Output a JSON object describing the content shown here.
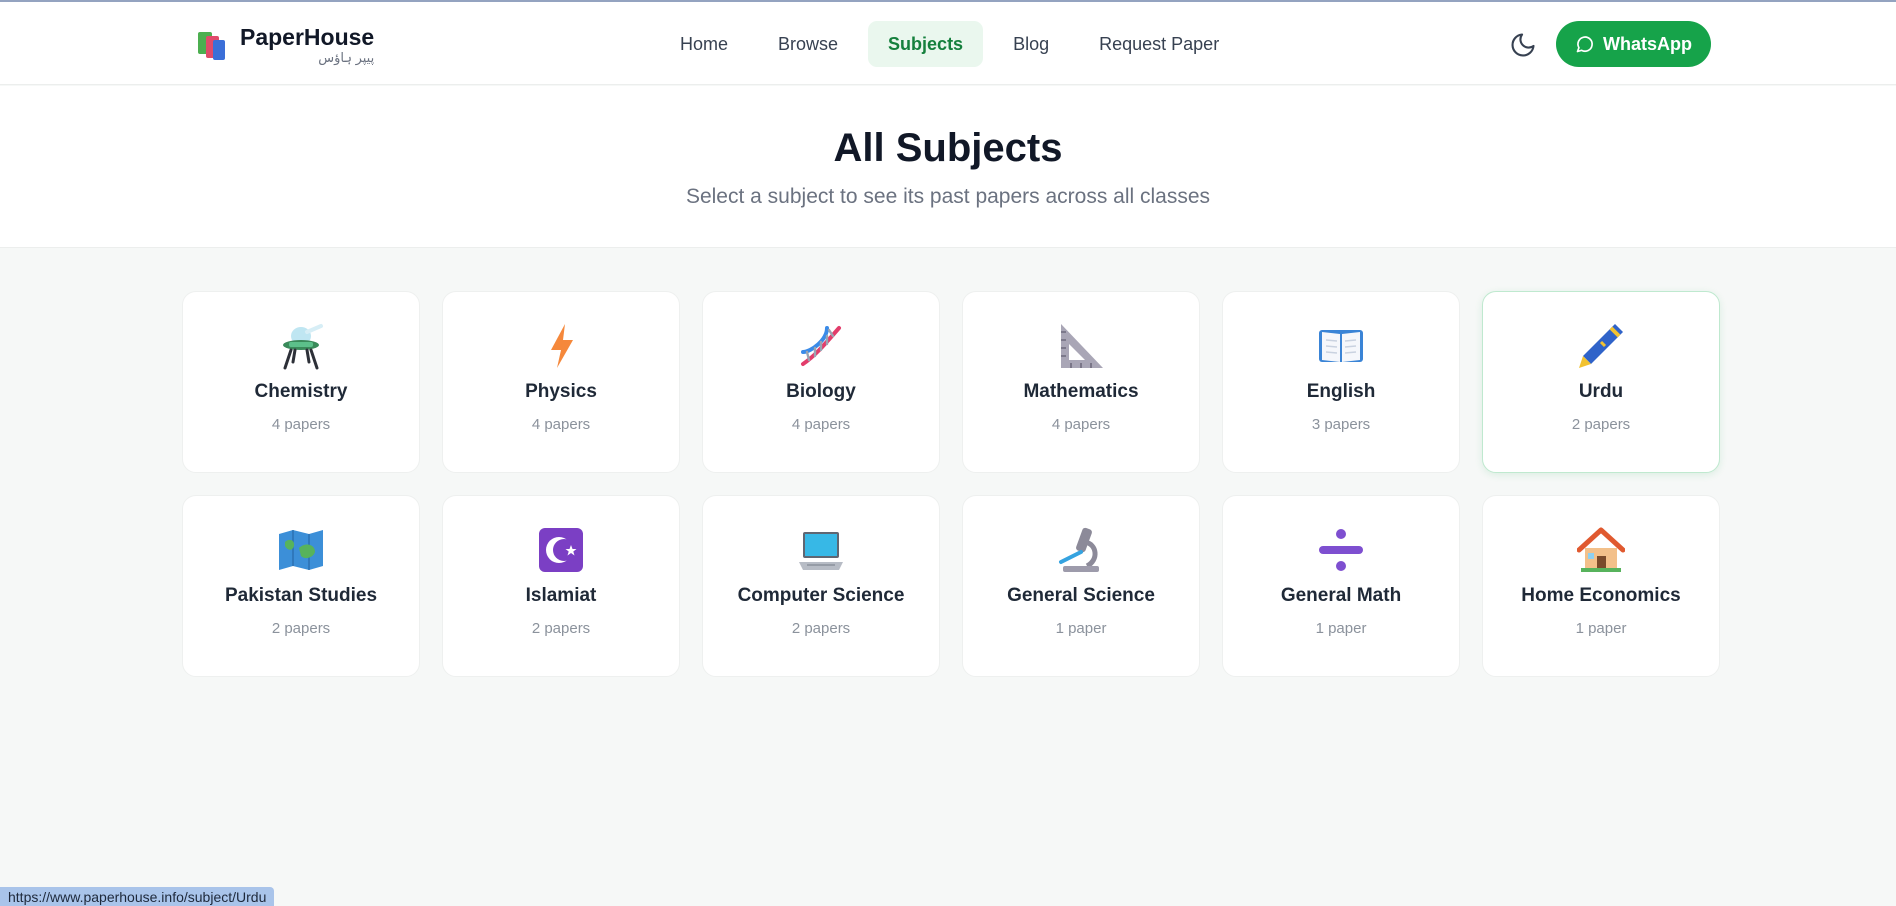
{
  "brand": {
    "name": "PaperHouse",
    "subtitle": "پیپر ہاؤس"
  },
  "nav": {
    "home": "Home",
    "browse": "Browse",
    "subjects": "Subjects",
    "blog": "Blog",
    "request": "Request Paper"
  },
  "whatsapp": {
    "label": "WhatsApp"
  },
  "hero": {
    "title": "All Subjects",
    "subtitle": "Select a subject to see its past papers across all classes"
  },
  "subjects": [
    {
      "name": "Chemistry",
      "count": "4 papers",
      "icon": "test-tube-icon"
    },
    {
      "name": "Physics",
      "count": "4 papers",
      "icon": "lightning-icon"
    },
    {
      "name": "Biology",
      "count": "4 papers",
      "icon": "dna-icon"
    },
    {
      "name": "Mathematics",
      "count": "4 papers",
      "icon": "triangle-ruler-icon"
    },
    {
      "name": "English",
      "count": "3 papers",
      "icon": "open-book-icon"
    },
    {
      "name": "Urdu",
      "count": "2 papers",
      "icon": "pen-icon"
    },
    {
      "name": "Pakistan Studies",
      "count": "2 papers",
      "icon": "world-map-icon"
    },
    {
      "name": "Islamiat",
      "count": "2 papers",
      "icon": "crescent-star-icon"
    },
    {
      "name": "Computer Science",
      "count": "2 papers",
      "icon": "laptop-icon"
    },
    {
      "name": "General Science",
      "count": "1 paper",
      "icon": "microscope-icon"
    },
    {
      "name": "General Math",
      "count": "1 paper",
      "icon": "divide-icon"
    },
    {
      "name": "Home Economics",
      "count": "1 paper",
      "icon": "house-icon"
    }
  ],
  "status_bar": {
    "url": "https://www.paperhouse.info/subject/Urdu"
  },
  "colors": {
    "accent": "#16a34a",
    "active_nav_bg": "#eaf7ee",
    "active_nav_text": "#15803d"
  }
}
